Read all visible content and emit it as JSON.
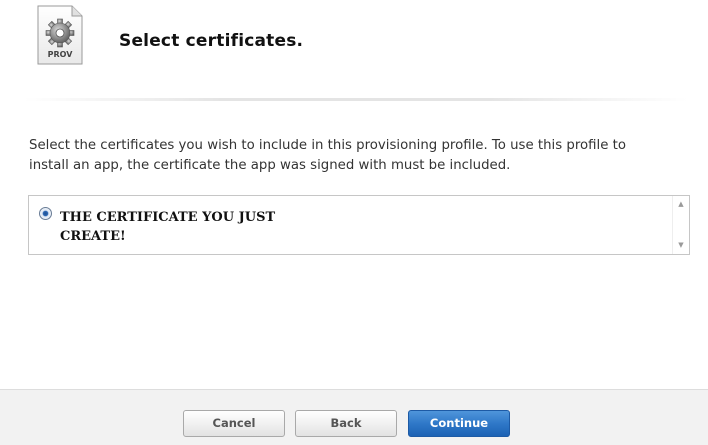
{
  "header": {
    "icon_name": "provisioning-profile-icon",
    "icon_label": "PROV",
    "title": "Select certificates."
  },
  "description": "Select the certificates you wish to include in this provisioning profile. To use this profile to install an app, the certificate the app was signed with must be included.",
  "certificates": {
    "items": [
      {
        "label": "THE CERTIFICATE YOU JUST CREATE!",
        "selected": true
      }
    ]
  },
  "footer": {
    "cancel_label": "Cancel",
    "back_label": "Back",
    "continue_label": "Continue"
  },
  "colors": {
    "primary_button": "#2f78c8",
    "footer_background": "#f2f2f2"
  }
}
